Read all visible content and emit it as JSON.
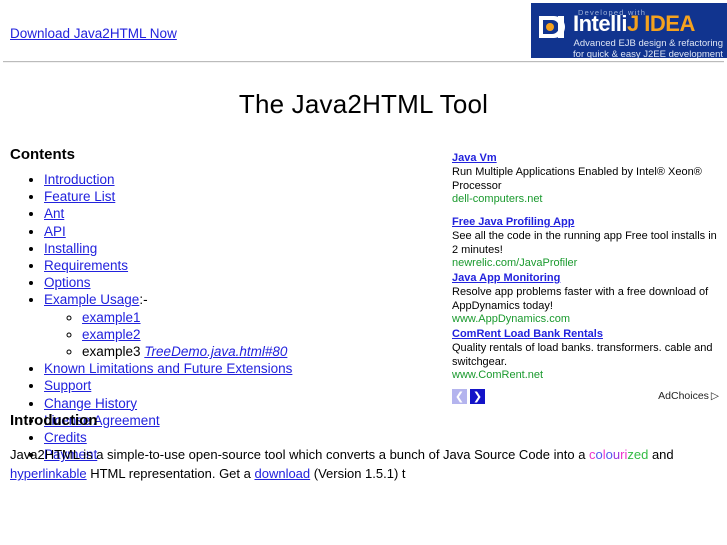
{
  "header": {
    "download_link": "Download Java2HTML Now",
    "banner": {
      "developed_with": "Developed with",
      "brand_part1": "Intelli",
      "brand_part2": "J IDEA",
      "tagline_line1": "Advanced EJB design & refactoring",
      "tagline_line2": "for quick & easy J2EE development",
      "bg_color": "#11348f",
      "accent_color": "#f5a21e"
    }
  },
  "page": {
    "title": "The Java2HTML Tool"
  },
  "contents": {
    "heading": "Contents",
    "items": [
      {
        "label": "Introduction",
        "type": "link"
      },
      {
        "label": "Feature List",
        "type": "link"
      },
      {
        "label": "Ant",
        "type": "link"
      },
      {
        "label": "API",
        "type": "link"
      },
      {
        "label": "Installing",
        "type": "link"
      },
      {
        "label": "Requirements",
        "type": "link"
      },
      {
        "label": "Options",
        "type": "link"
      },
      {
        "label": "Example Usage",
        "type": "link",
        "suffix": ":-"
      }
    ],
    "sub_items": [
      {
        "label": "example1",
        "type": "link"
      },
      {
        "label": "example2",
        "type": "link"
      },
      {
        "label": "example3",
        "type": "text",
        "link_label": "TreeDemo.java.html#80"
      }
    ],
    "items_after": [
      {
        "label": "Known Limitations and Future Extensions",
        "type": "link"
      },
      {
        "label": "Support",
        "type": "link"
      },
      {
        "label": "Change History",
        "type": "link"
      },
      {
        "label": "License Agreement",
        "type": "link"
      },
      {
        "label": "Credits",
        "type": "link"
      },
      {
        "label": "Payment",
        "type": "link"
      }
    ]
  },
  "ads": {
    "items": [
      {
        "title": "Java Vm",
        "desc": "Run Multiple Applications Enabled by Intel® Xeon® Processor",
        "url": "dell-computers.net"
      },
      {
        "title": "Free Java Profiling App",
        "desc": "See all the code in the running app Free tool installs in 2 minutes!",
        "url": "newrelic.com/JavaProfiler"
      },
      {
        "title": "Java App Monitoring",
        "desc": "Resolve app problems faster with a free download of AppDynamics today!",
        "url": "www.AppDynamics.com"
      },
      {
        "title": "ComRent Load Bank Rentals",
        "desc": "Quality rentals of load banks. transformers. cable and switchgear.",
        "url": "www.ComRent.net"
      }
    ],
    "prev_glyph": "❮",
    "next_glyph": "❯",
    "adchoices_label": "AdChoices",
    "adchoices_glyph": "▷",
    "url_color": "#1a9a2e",
    "next_color": "#1313c8",
    "prev_color": "#b4b4ee"
  },
  "introduction": {
    "heading": "Introduction",
    "para_start": "Java2HTML is a simple-to-use open-source tool which converts a bunch of Java Source Code into a ",
    "colourized": {
      "l1": "c",
      "l2": "o",
      "l3": "l",
      "l4": "o",
      "l5": "u",
      "l6": "r",
      "l7": "i",
      "l8": "z",
      "l9": "e",
      "l10": "d"
    },
    "para_after": " and",
    "line2_part1": "hyperlinkable",
    "line2_part2": " HTML representation. Get a ",
    "line2_link": "download",
    "line2_part3": " (Version 1.5.1) t"
  }
}
